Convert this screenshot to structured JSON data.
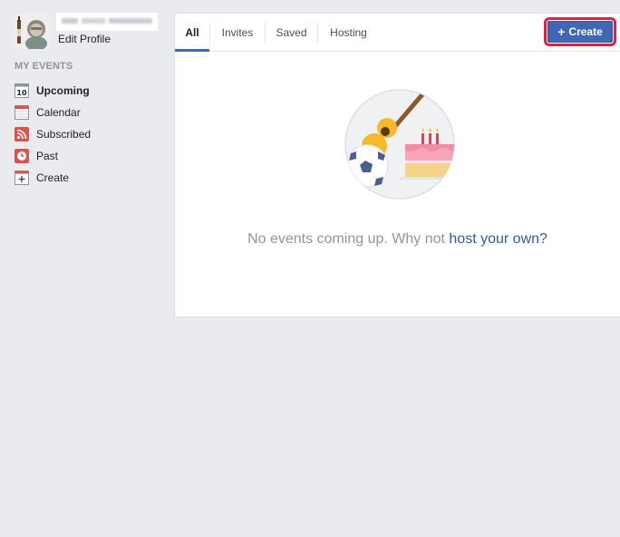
{
  "profile": {
    "edit_label": "Edit Profile"
  },
  "sidebar": {
    "section_title": "MY EVENTS",
    "calendar_day": "10",
    "items": [
      {
        "label": "Upcoming",
        "icon": "calendar-date-icon",
        "active": true
      },
      {
        "label": "Calendar",
        "icon": "calendar-grid-icon"
      },
      {
        "label": "Subscribed",
        "icon": "rss-icon"
      },
      {
        "label": "Past",
        "icon": "clock-icon"
      },
      {
        "label": "Create",
        "icon": "plus-box-icon"
      }
    ]
  },
  "tabs": [
    {
      "label": "All",
      "active": true
    },
    {
      "label": "Invites"
    },
    {
      "label": "Saved"
    },
    {
      "label": "Hosting"
    }
  ],
  "create_button": {
    "label": "Create",
    "icon": "plus-icon"
  },
  "empty_state": {
    "message": "No events coming up. Why not ",
    "link_text": "host your own?"
  },
  "colors": {
    "accent": "#4267b2",
    "highlight": "#e41e3f",
    "background": "#e9ebee"
  }
}
